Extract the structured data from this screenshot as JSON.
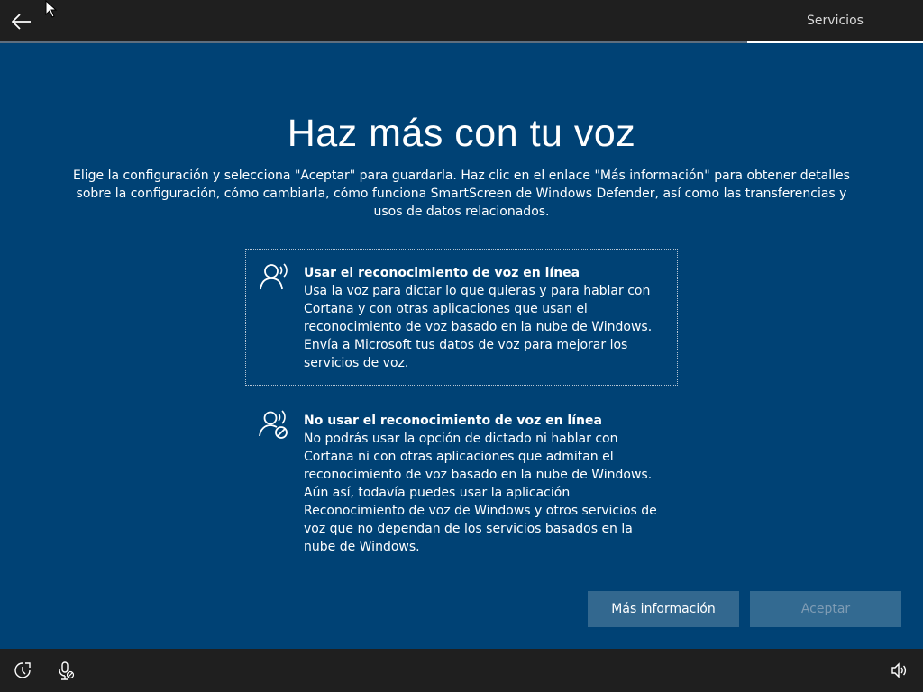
{
  "header": {
    "back_icon": "arrow-left-icon",
    "tab_label": "Servicios"
  },
  "main": {
    "title": "Haz más con tu voz",
    "description": "Elige la configuración y selecciona \"Aceptar\" para guardarla. Haz clic en el enlace \"Más información\" para obtener detalles sobre la configuración, cómo cambiarla, cómo funciona SmartScreen de Windows Defender, así como las transferencias y usos de datos relacionados.",
    "options": [
      {
        "icon": "speech-person-icon",
        "title": "Usar el reconocimiento de voz en línea",
        "text": "Usa la voz para dictar lo que quieras y para hablar con Cortana y con otras aplicaciones que usan el reconocimiento de voz basado en la nube de Windows. Envía a Microsoft tus datos de voz para mejorar los servicios de voz.",
        "selected": true
      },
      {
        "icon": "speech-person-blocked-icon",
        "title": "No usar el reconocimiento de voz en línea",
        "text": "No podrás usar la opción de dictado ni hablar con Cortana ni con otras aplicaciones que admitan el reconocimiento de voz basado en la nube de Windows. Aún así, todavía puedes usar la aplicación Reconocimiento de voz de Windows y otros servicios de voz que no dependan de los servicios basados en la nube de Windows.",
        "selected": false
      }
    ]
  },
  "buttons": {
    "more_info": "Más información",
    "accept": "Aceptar"
  },
  "footer": {
    "icons": [
      "ease-of-access-icon",
      "microphone-blocked-icon",
      "volume-icon"
    ]
  },
  "colors": {
    "background": "#004275",
    "bars": "#1f1f1f",
    "button": "#33688f"
  }
}
